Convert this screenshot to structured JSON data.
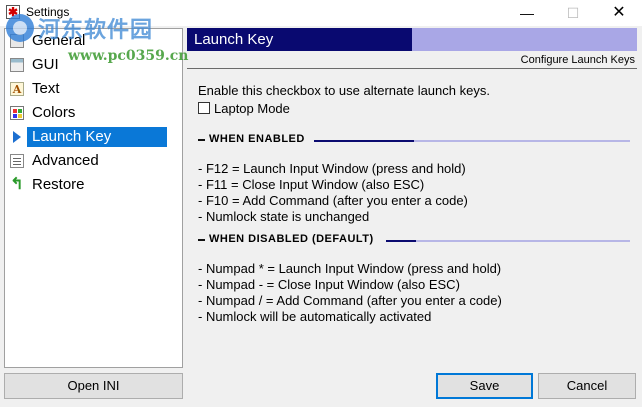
{
  "window": {
    "title": "Settings",
    "app_icon_glyph": "✱",
    "controls": {
      "minimize": "—",
      "maximize": "☐",
      "close": "✕"
    }
  },
  "watermark": {
    "title": "河东软件园",
    "url": "www.pc0359.cn"
  },
  "sidebar": {
    "items": [
      {
        "label": "General",
        "icon": "general-icon"
      },
      {
        "label": "GUI",
        "icon": "gui-icon"
      },
      {
        "label": "Text",
        "icon": "text-icon",
        "glyph": "A"
      },
      {
        "label": "Colors",
        "icon": "colors-icon"
      },
      {
        "label": "Launch Key",
        "icon": "play-arrow-icon",
        "selected": true
      },
      {
        "label": "Advanced",
        "icon": "advanced-icon"
      },
      {
        "label": "Restore",
        "icon": "restore-arrow-icon",
        "glyph": "↰"
      }
    ]
  },
  "panel": {
    "header_title": "Launch Key",
    "subheader": "Configure Launch Keys",
    "intro": "Enable this checkbox to use alternate launch keys.",
    "checkbox_label": "Laptop Mode",
    "checkbox_checked": false,
    "when_enabled": {
      "title": "WHEN ENABLED",
      "lines": [
        "- F12 = Launch Input Window (press and hold)",
        "- F11 = Close Input Window (also ESC)",
        "- F10 = Add Command (after you enter a code)",
        "- Numlock state is unchanged"
      ]
    },
    "when_disabled": {
      "title": "WHEN DISABLED (DEFAULT)",
      "lines": [
        "- Numpad * = Launch Input Window (press and hold)",
        "- Numpad - = Close Input Window (also ESC)",
        "- Numpad / = Add Command (after you enter a code)",
        "- Numlock will be automatically activated"
      ]
    }
  },
  "buttons": {
    "open_ini": "Open INI",
    "save": "Save",
    "cancel": "Cancel"
  },
  "colors": {
    "header_dark": "#090970",
    "header_light": "#a9a7e6",
    "selection": "#0a78d7"
  }
}
